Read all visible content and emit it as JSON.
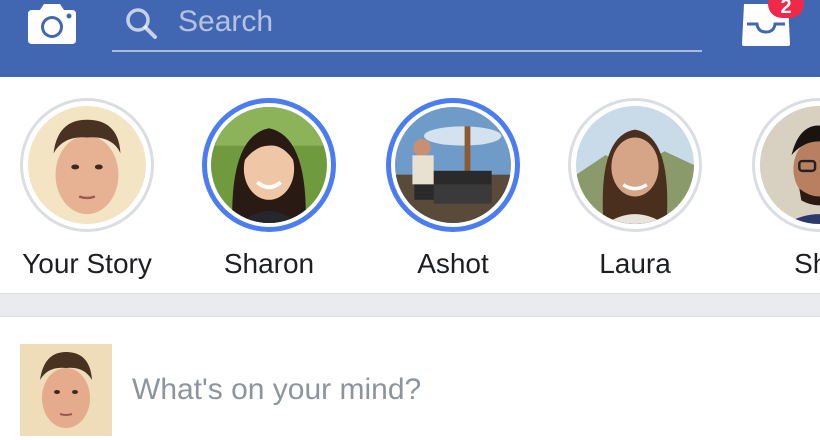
{
  "header": {
    "camera_icon": "camera-icon",
    "search_icon": "search-icon",
    "search_placeholder": "Search",
    "inbox_icon": "inbox-tray-icon",
    "notification_count": "2",
    "colors": {
      "bar": "#4267b2",
      "badge": "#f02849",
      "active_ring": "#4c7df0"
    }
  },
  "stories": [
    {
      "name": "Your Story",
      "active": false
    },
    {
      "name": "Sharon",
      "active": true
    },
    {
      "name": "Ashot",
      "active": true
    },
    {
      "name": "Laura",
      "active": false
    },
    {
      "name": "Sha",
      "active": false
    }
  ],
  "composer": {
    "prompt": "What's on your mind?"
  }
}
